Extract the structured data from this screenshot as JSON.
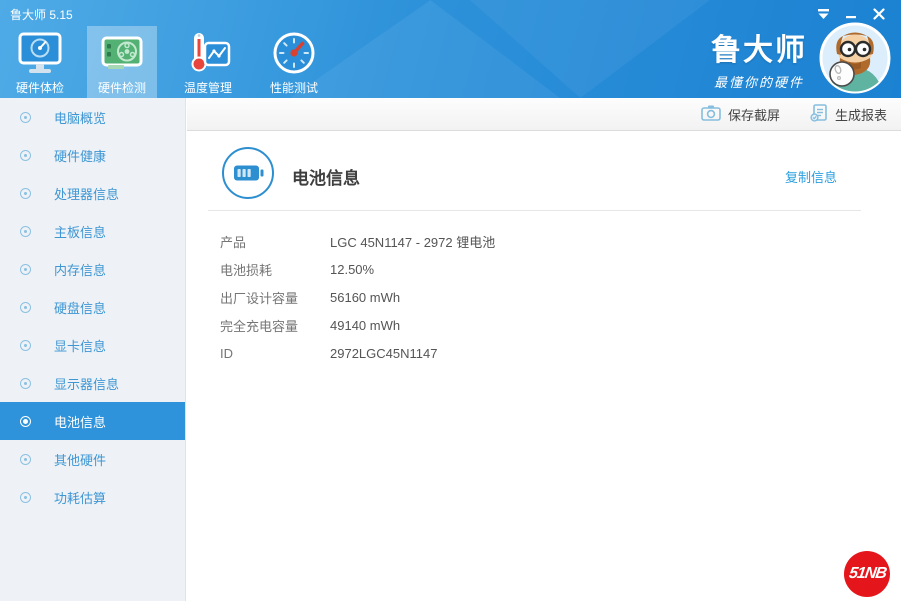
{
  "window": {
    "title": "鲁大师 5.15",
    "controls": {
      "menu_icon": "menu-chevron",
      "minimize_icon": "minimize",
      "close_icon": "close"
    }
  },
  "header": {
    "tabs": [
      {
        "label": "硬件体检",
        "icon": "monitor-radar-icon",
        "active": false
      },
      {
        "label": "硬件检测",
        "icon": "gpu-card-icon",
        "active": true
      },
      {
        "label": "温度管理",
        "icon": "thermometer-chart-icon",
        "active": false
      },
      {
        "label": "性能测试",
        "icon": "gauge-icon",
        "active": false
      }
    ],
    "brand": {
      "name": "鲁大师",
      "tagline": "最懂你的硬件",
      "avatar": "master-lu-mascot"
    }
  },
  "toolbar": {
    "buttons": [
      {
        "label": "保存截屏",
        "icon": "camera-icon"
      },
      {
        "label": "生成报表",
        "icon": "report-icon"
      }
    ]
  },
  "sidebar": {
    "items": [
      {
        "label": "电脑概览",
        "active": false
      },
      {
        "label": "硬件健康",
        "active": false
      },
      {
        "label": "处理器信息",
        "active": false
      },
      {
        "label": "主板信息",
        "active": false
      },
      {
        "label": "内存信息",
        "active": false
      },
      {
        "label": "硬盘信息",
        "active": false
      },
      {
        "label": "显卡信息",
        "active": false
      },
      {
        "label": "显示器信息",
        "active": false
      },
      {
        "label": "电池信息",
        "active": true
      },
      {
        "label": "其他硬件",
        "active": false
      },
      {
        "label": "功耗估算",
        "active": false
      }
    ]
  },
  "content": {
    "section_title": "电池信息",
    "section_icon": "battery-icon",
    "copy_link": "复制信息",
    "rows": [
      {
        "label": "产品",
        "value": "LGC 45N1147 - 2972 锂电池"
      },
      {
        "label": "电池损耗",
        "value": "12.50%"
      },
      {
        "label": "出厂设计容量",
        "value": "56160 mWh"
      },
      {
        "label": "完全充电容量",
        "value": "49140 mWh"
      },
      {
        "label": "ID",
        "value": "2972LGC45N1147"
      }
    ]
  },
  "watermark": {
    "text": "51NB"
  },
  "colors": {
    "header_blue_light": "#4fabe6",
    "header_blue_dark": "#1b81d2",
    "sidebar_bg": "#eef2f6",
    "sidebar_active_bg": "#2e93da",
    "sidebar_text": "#3e96d3",
    "accent_blue": "#2e8fd0",
    "link_blue": "#2b9fe0",
    "watermark_red": "#e5161b"
  }
}
